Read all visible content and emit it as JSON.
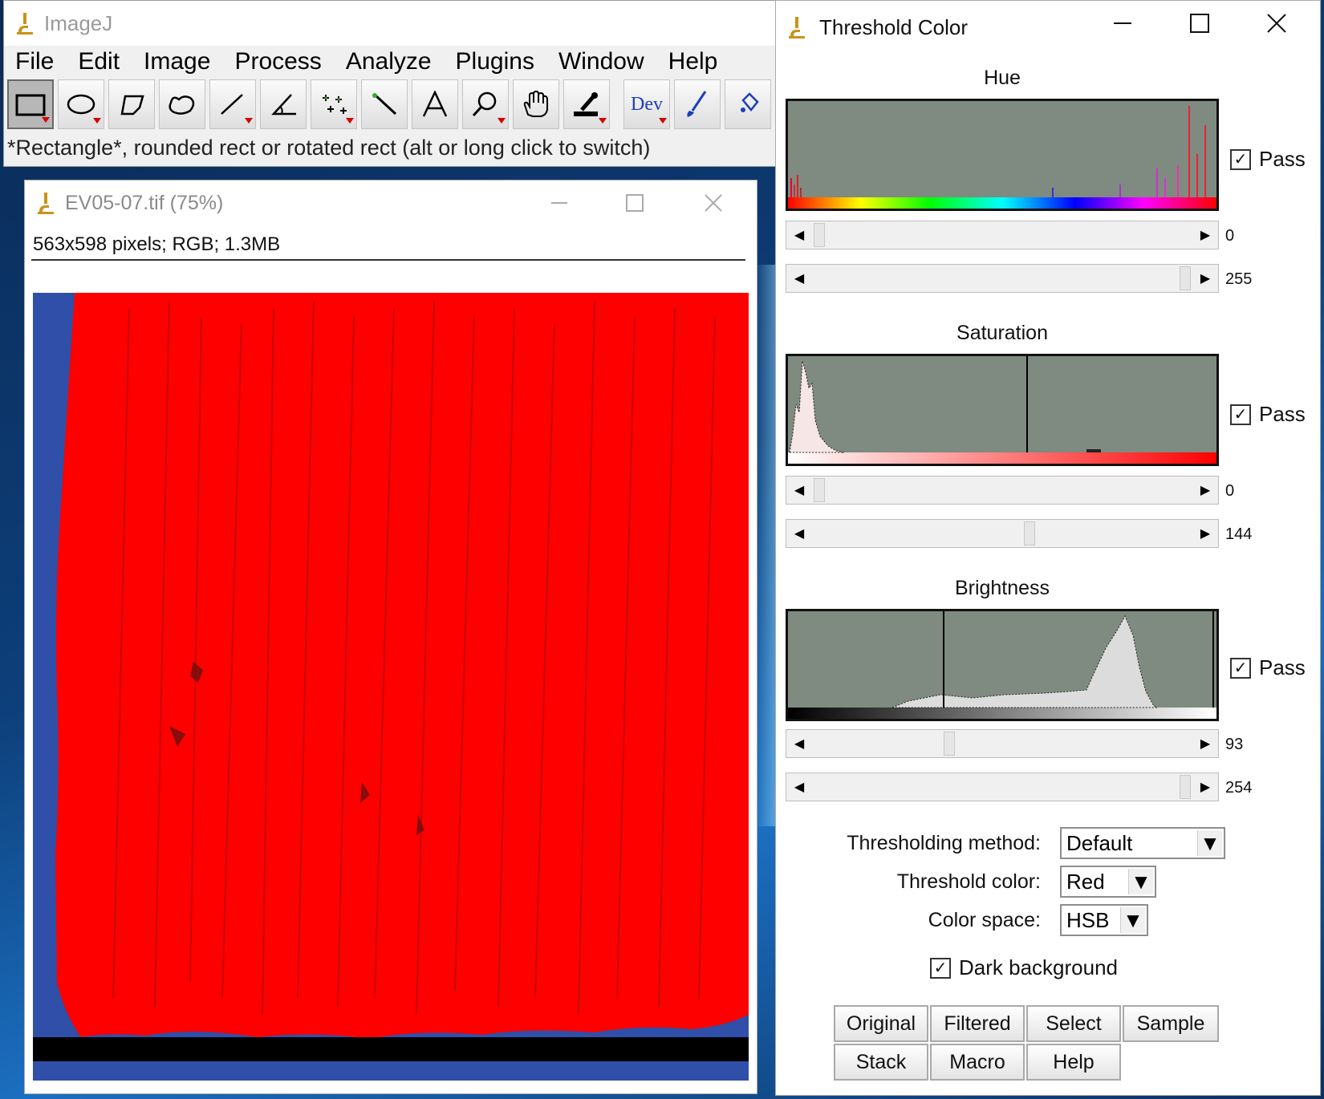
{
  "main_window": {
    "title": "ImageJ",
    "menus": [
      "File",
      "Edit",
      "Image",
      "Process",
      "Analyze",
      "Plugins",
      "Window",
      "Help"
    ],
    "tools": [
      "rectangle-tool",
      "oval-tool",
      "polygon-tool",
      "freehand-tool",
      "line-tool",
      "angle-tool",
      "multipoint-tool",
      "wand-tool",
      "text-tool",
      "magnifier-tool",
      "hand-tool",
      "color-picker-tool",
      "dev-tool",
      "brush-tool",
      "flood-fill-tool"
    ],
    "dev_label": "Dev",
    "status": "*Rectangle*, rounded rect or rotated rect (alt or long click to switch)"
  },
  "image_window": {
    "title": "EV05-07.tif (75%)",
    "info": "563x598 pixels; RGB; 1.3MB"
  },
  "threshold_window": {
    "title": "Threshold Color",
    "hue": {
      "label": "Hue",
      "pass_label": "Pass",
      "pass_checked": true,
      "min": "0",
      "max": "255"
    },
    "saturation": {
      "label": "Saturation",
      "pass_label": "Pass",
      "pass_checked": true,
      "min": "0",
      "max": "144"
    },
    "brightness": {
      "label": "Brightness",
      "pass_label": "Pass",
      "pass_checked": true,
      "min": "93",
      "max": "254"
    },
    "method_label": "Thresholding method:",
    "method_value": "Default",
    "color_label": "Threshold color:",
    "color_value": "Red",
    "space_label": "Color space:",
    "space_value": "HSB",
    "dark_bg_label": "Dark background",
    "dark_bg_checked": true,
    "buttons": [
      "Original",
      "Filtered",
      "Select",
      "Sample",
      "Stack",
      "Macro",
      "Help"
    ]
  },
  "colors": {
    "threshold_red": "#ff0000",
    "image_blue": "#2f4fa8",
    "hist_bg": "#7f8a80"
  }
}
